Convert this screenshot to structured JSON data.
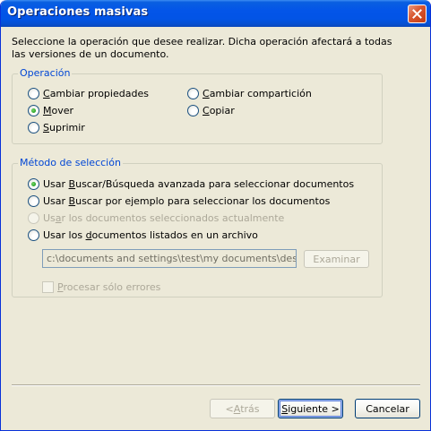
{
  "window": {
    "title": "Operaciones masivas"
  },
  "intro_text": "Seleccione la operación que desee realizar. Dicha operación afectará a todas las versiones de un documento.",
  "operation_group": {
    "label": "Operación",
    "options": [
      {
        "pre": "",
        "key": "C",
        "post": "ambiar propiedades",
        "checked": false
      },
      {
        "pre": "",
        "key": "C",
        "post": "ambiar compartición",
        "checked": false
      },
      {
        "pre": "",
        "key": "M",
        "post": "over",
        "checked": true
      },
      {
        "pre": "",
        "key": "C",
        "post": "opiar",
        "checked": false
      },
      {
        "pre": "",
        "key": "S",
        "post": "uprimir",
        "checked": false
      }
    ]
  },
  "selection_group": {
    "label": "Método de selección",
    "options": [
      {
        "pre": "Usar ",
        "key": "B",
        "post": "uscar/Búsqueda avanzada para seleccionar documentos",
        "checked": true,
        "enabled": true
      },
      {
        "pre": "Usar ",
        "key": "B",
        "post": "uscar por ejemplo para seleccionar los documentos",
        "checked": false,
        "enabled": true
      },
      {
        "pre": "Us",
        "key": "a",
        "post": "r los documentos seleccionados actualmente",
        "checked": false,
        "enabled": false
      },
      {
        "pre": "Usar los ",
        "key": "d",
        "post": "ocumentos listados en un archivo",
        "checked": false,
        "enabled": true
      }
    ],
    "file_path": "c:\\documents and settings\\test\\my documents\\desktop.ini",
    "browse_label": "Examinar",
    "errors_only": {
      "pre": "",
      "key": "P",
      "post": "rocesar sólo errores",
      "checked": false
    }
  },
  "buttons": {
    "back": {
      "pre": "< ",
      "key": "A",
      "post": "trás"
    },
    "next": {
      "pre": "",
      "key": "S",
      "post": "iguiente >"
    },
    "cancel": "Cancelar"
  },
  "colors": {
    "title_bar": "#0054E3",
    "dialog_bg": "#ECE9D8",
    "group_label": "#0046D5",
    "radio_checked": "#21A121",
    "close_button": "#D8552E"
  },
  "icons": {
    "close": "close-icon"
  }
}
